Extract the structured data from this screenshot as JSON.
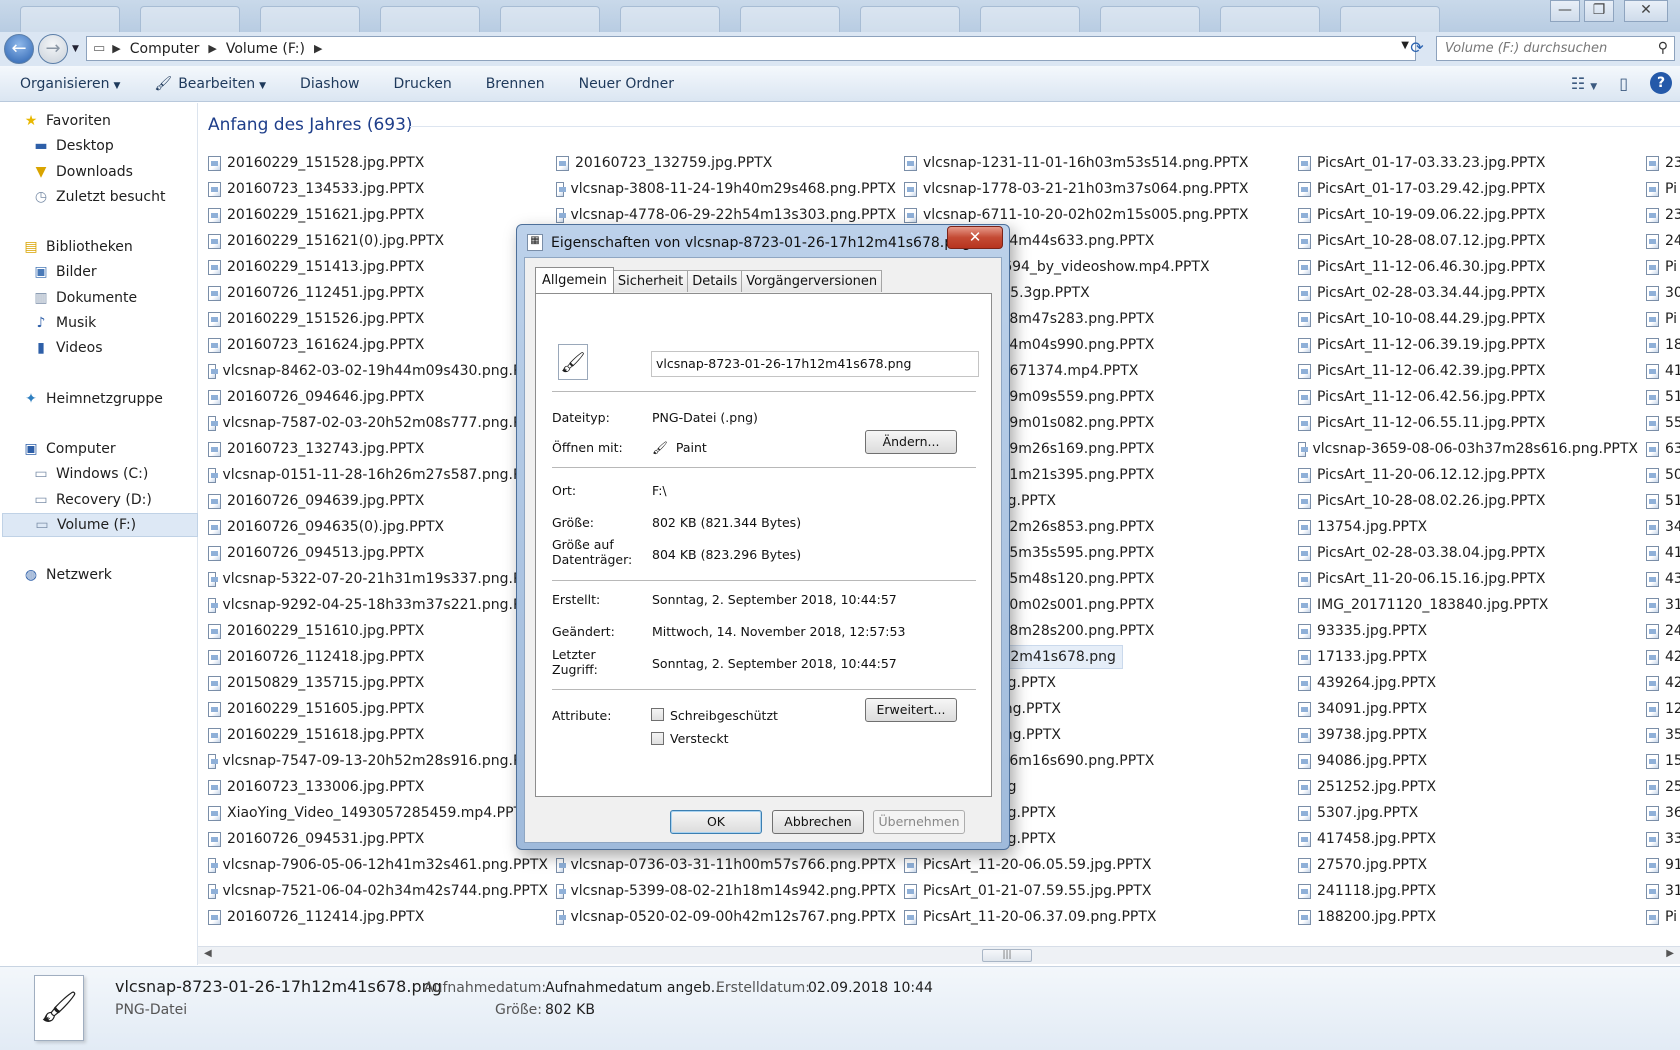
{
  "window": {
    "minimize": "—",
    "maximize": "❐",
    "close": "✕"
  },
  "address": {
    "crumbs": [
      "Computer",
      "Volume (F:)"
    ],
    "search_placeholder": "Volume (F:) durchsuchen"
  },
  "toolbar": {
    "organize": "Organisieren",
    "edit": "Bearbeiten",
    "slideshow": "Diashow",
    "print": "Drucken",
    "burn": "Brennen",
    "new_folder": "Neuer Ordner"
  },
  "nav": {
    "favorites": "Favoriten",
    "desktop": "Desktop",
    "downloads": "Downloads",
    "recent": "Zuletzt besucht",
    "libraries": "Bibliotheken",
    "pictures": "Bilder",
    "documents": "Dokumente",
    "music": "Musik",
    "videos": "Videos",
    "homegroup": "Heimnetzgruppe",
    "computer": "Computer",
    "drive_c": "Windows (C:)",
    "drive_d": "Recovery (D:)",
    "drive_f": "Volume (F:)",
    "network": "Netzwerk"
  },
  "content": {
    "group_title": "Anfang des Jahres (693)",
    "columns": [
      [
        "20160229_151528.jpg.PPTX",
        "20160723_134533.jpg.PPTX",
        "20160229_151621.jpg.PPTX",
        "20160229_151621(0).jpg.PPTX",
        "20160229_151413.jpg.PPTX",
        "20160726_112451.jpg.PPTX",
        "20160229_151526.jpg.PPTX",
        "20160723_161624.jpg.PPTX",
        "vlcsnap-8462-03-02-19h44m09s430.png.PPTX",
        "20160726_094646.jpg.PPTX",
        "vlcsnap-7587-02-03-20h52m08s777.png.PPTX",
        "20160723_132743.jpg.PPTX",
        "vlcsnap-0151-11-28-16h26m27s587.png.PPTX",
        "20160726_094639.jpg.PPTX",
        "20160726_094635(0).jpg.PPTX",
        "20160726_094513.jpg.PPTX",
        "vlcsnap-5322-07-20-21h31m19s337.png.PPTX",
        "vlcsnap-9292-04-25-18h33m37s221.png.PPTX",
        "20160229_151610.jpg.PPTX",
        "20160726_112418.jpg.PPTX",
        "20150829_135715.jpg.PPTX",
        "20160229_151605.jpg.PPTX",
        "20160229_151618.jpg.PPTX",
        "vlcsnap-7547-09-13-20h52m28s916.png.PPTX",
        "20160723_133006.jpg.PPTX",
        "XiaoYing_Video_1493057285459.mp4.PPTX",
        "20160726_094531.jpg.PPTX",
        "vlcsnap-7906-05-06-12h41m32s461.png.PPTX",
        "vlcsnap-7521-06-04-02h34m42s744.png.PPTX",
        "20160726_112414.jpg.PPTX"
      ],
      [
        "20160723_132759.jpg.PPTX",
        "vlcsnap-3808-11-24-19h40m29s468.png.PPTX",
        "vlcsnap-4778-06-29-22h54m13s303.png.PPTX",
        "",
        "",
        "",
        "",
        "",
        "",
        "",
        "",
        "",
        "",
        "",
        "",
        "",
        "",
        "",
        "",
        "",
        "",
        "",
        "",
        "",
        "",
        "",
        "",
        "vlcsnap-0736-03-31-11h00m57s766.png.PPTX",
        "vlcsnap-5399-08-02-21h18m14s942.png.PPTX",
        "vlcsnap-0520-02-09-00h42m12s767.png.PPTX"
      ],
      [
        "vlcsnap-1231-11-01-16h03m53s514.png.PPTX",
        "vlcsnap-1778-03-21-21h03m37s064.png.PPTX",
        "vlcsnap-6711-10-20-02h02m15s005.png.PPTX",
        "-03-28-02h34m44s633.png.PPTX",
        "424200921694_by_videoshow.mp4.PPTX",
        "5_185249555.3gp.PPTX",
        "-04-07-16h48m47s283.png.PPTX",
        "-02-12-15h34m04s990.png.PPTX",
        "eo_1493662671374.mp4.PPTX",
        "-01-09-02h29m09s559.png.PPTX",
        "-05-11-02h49m01s082.png.PPTX",
        "-12-31-19h59m26s169.png.PPTX",
        "-09-20-07h11m21s395.png.PPTX",
        "-07.48.03.jpg.PPTX",
        "-08-02-08h22m26s853.png.PPTX",
        "-07-27-05h15m35s595.png.PPTX",
        "-03-20-06h25m48s120.png.PPTX",
        "-05-22-06h10m02s001.png.PPTX",
        "-01-10-04h58m28s200.png.PPTX",
        "-01-26-17h12m41s678.png",
        "-07.05.05.jpg.PPTX",
        "-06.33.37.png.PPTX",
        "-06.34.50.png.PPTX",
        "-08-12-06h56m16s690.png.PPTX",
        "-07.47.45.jpg",
        "-03.53.48.jpg.PPTX",
        "-06.05.10.jpg.PPTX",
        "PicsArt_11-20-06.05.59.jpg.PPTX",
        "PicsArt_01-21-07.59.55.jpg.PPTX",
        "PicsArt_11-20-06.37.09.png.PPTX"
      ],
      [
        "PicsArt_01-17-03.33.23.jpg.PPTX",
        "PicsArt_01-17-03.29.42.jpg.PPTX",
        "PicsArt_10-19-09.06.22.jpg.PPTX",
        "PicsArt_10-28-08.07.12.jpg.PPTX",
        "PicsArt_11-12-06.46.30.jpg.PPTX",
        "PicsArt_02-28-03.34.44.jpg.PPTX",
        "PicsArt_10-10-08.44.29.jpg.PPTX",
        "PicsArt_11-12-06.39.19.jpg.PPTX",
        "PicsArt_11-12-06.42.39.jpg.PPTX",
        "PicsArt_11-12-06.42.56.jpg.PPTX",
        "PicsArt_11-12-06.55.11.jpg.PPTX",
        "vlcsnap-3659-08-06-03h37m28s616.png.PPTX",
        "PicsArt_11-20-06.12.12.jpg.PPTX",
        "PicsArt_10-28-08.02.26.jpg.PPTX",
        "13754.jpg.PPTX",
        "PicsArt_02-28-03.38.04.jpg.PPTX",
        "PicsArt_11-20-06.15.16.jpg.PPTX",
        "IMG_20171120_183840.jpg.PPTX",
        "93335.jpg.PPTX",
        "17133.jpg.PPTX",
        "439264.jpg.PPTX",
        "34091.jpg.PPTX",
        "39738.jpg.PPTX",
        "94086.jpg.PPTX",
        "251252.jpg.PPTX",
        "5307.jpg.PPTX",
        "417458.jpg.PPTX",
        "27570.jpg.PPTX",
        "241118.jpg.PPTX",
        "188200.jpg.PPTX"
      ],
      [
        "23",
        "Pi",
        "23",
        "24",
        "Pi",
        "30",
        "Pi",
        "18",
        "41",
        "51",
        "55",
        "63",
        "50",
        "51",
        "34",
        "41",
        "43",
        "31",
        "24",
        "42",
        "42",
        "12",
        "35",
        "15",
        "25",
        "36",
        "33",
        "91",
        "31",
        "Pi"
      ]
    ]
  },
  "dialog": {
    "title": "Eigenschaften von vlcsnap-8723-01-26-17h12m41s678.png",
    "close": "✕",
    "tabs": [
      "Allgemein",
      "Sicherheit",
      "Details",
      "Vorgängerversionen"
    ],
    "filename": "vlcsnap-8723-01-26-17h12m41s678.png",
    "filetype_label": "Dateityp:",
    "filetype_value": "PNG-Datei (.png)",
    "openwith_label": "Öffnen mit:",
    "openwith_value": "Paint",
    "change_button": "Ändern...",
    "location_label": "Ort:",
    "location_value": "F:\\",
    "size_label": "Größe:",
    "size_value": "802 KB (821.344 Bytes)",
    "disksize_label_1": "Größe auf",
    "disksize_label_2": "Datenträger:",
    "disksize_value": "804 KB (823.296 Bytes)",
    "created_label": "Erstellt:",
    "created_value": "Sonntag, 2. September 2018, 10:44:57",
    "modified_label": "Geändert:",
    "modified_value": "Mittwoch, 14. November 2018, 12:57:53",
    "accessed_label_1": "Letzter",
    "accessed_label_2": "Zugriff:",
    "accessed_value": "Sonntag, 2. September 2018, 10:44:57",
    "attributes_label": "Attribute:",
    "readonly_label": "Schreibgeschützt",
    "hidden_label": "Versteckt",
    "advanced_button": "Erweitert...",
    "ok_button": "OK",
    "cancel_button": "Abbrechen",
    "apply_button": "Übernehmen"
  },
  "details": {
    "name": "vlcsnap-8723-01-26-17h12m41s678.png",
    "type": "PNG-Datei",
    "taken_label": "Aufnahmedatum:",
    "taken_value": "Aufnahmedatum angeb...",
    "created_label": "Erstelldatum:",
    "created_value": "02.09.2018 10:44",
    "size_label": "Größe:",
    "size_value": "802 KB"
  },
  "colors": {
    "accent": "#1e3e8a",
    "dialog_frame": "#9fbadb",
    "close_red": "#c44a34"
  }
}
